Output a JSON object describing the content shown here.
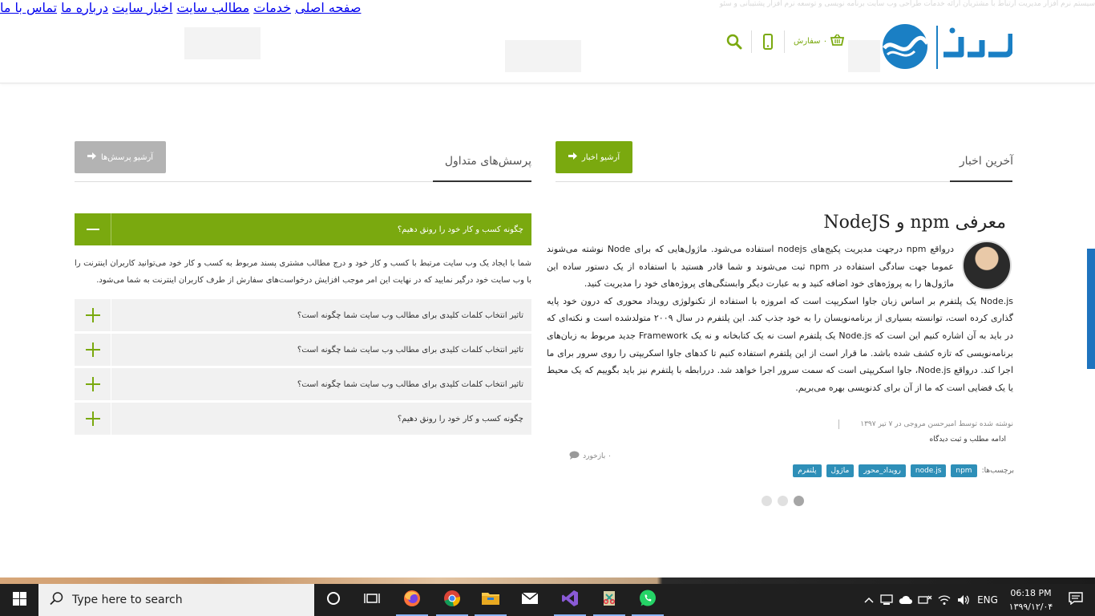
{
  "header": {
    "nav": [
      "صفحه اصلی",
      "خدمات",
      "مطالب سایت",
      "اخبار سایت",
      "درباره ما",
      "تماس با ما"
    ],
    "cart_label": "۰ سفارش",
    "ghost_text": "سیستم نرم افزار مدیریت ارتباط با مشتریان   ارائه خدمات طراحی وب سایت   برنامه نویسی و توسعه نرم افزار   پشتیبانی و سئو"
  },
  "news": {
    "section_title": "آخرین اخبار",
    "archive_button": "آرشیو اخبار",
    "title": "معرفی npm و NodeJS",
    "paragraphs": [
      "درواقع npm درجهت مدیریت پکیج‌های nodejs استفاده می‌شود. ماژول‌هایی که برای Node نوشته می‌شوند عموما جهت سادگی استفاده در npm ثبت می‌شوند و شما قادر هستید با استفاده از یک دستور ساده این ماژول‌ها را به پروژه‌های خود اضافه کنید و به عبارت دیگر وابستگی‌های پروژه‌های خود را مدیریت کنید.",
      "Node.js یک پلتفرم بر اساس زبان جاوا اسکریپت است که امروزه با استفاده از تکنولوژی رویداد محوری که درون خود پایه گذاری کرده است، توانسته بسیاری از برنامه‌نویسان را به خود جذب کند. این پلتفرم در سال ۲۰۰۹ متولدشده است و نکته‌ای که در باید به آن اشاره کنیم این است که Node.js یک پلتفرم است نه یک کتابخانه و نه یک Framework جدید مربوط به زبان‌های برنامه‌نویسی که تازه کشف شده باشد. ما قرار است از این پلتفرم استفاده کنیم تا کدهای جاوا اسکریپتی را روی سرور برای ما اجرا کند. درواقع Node.js، جاوا اسکریپتی است که سمت سرور اجرا خواهد شد. دررابطه با پلتفرم نیز باید بگوییم که یک محیط یا یک فضایی است که ما از آن برای کدنویسی بهره می‌بریم."
    ],
    "author_line": "نوشته شده توسط امیرحسن مروجی در ۷ تیر ۱۳۹۷",
    "read_more": "ادامه مطلب و ثبت دیدگاه",
    "comments": "۰ بازخورد",
    "tags_label": "برچسب‌ها:",
    "tags": [
      "npm",
      "node.js",
      "رویداد_محور",
      "ماژول",
      "پلتفرم"
    ]
  },
  "faq": {
    "section_title": "پرسش‌های متداول",
    "archive_button": "آرشیو پرسش‌ها",
    "open_question": "چگونه کسب و کار خود را رونق دهیم؟",
    "open_answer": "شما با ایجاد یک وب سایت مرتبط با کسب و کار خود و درج مطالب مشتری پسند مربوط به کسب و کار خود می‌توانید کاربران اینترنت را با وب سایت خود درگیر نمایید که در نهایت این امر موجب افزایش درخواست‌های سفارش از طرف کاربران اینترنت به شما می‌شود.",
    "items": [
      "تاثیر انتخاب کلمات کلیدی برای مطالب وب سایت شما چگونه است؟",
      "تاثیر انتخاب کلمات کلیدی برای مطالب وب سایت شما چگونه است؟",
      "تاثیر انتخاب کلمات کلیدی برای مطالب وب سایت شما چگونه است؟",
      "چگونه کسب و کار خود را رونق دهیم؟"
    ]
  },
  "taskbar": {
    "search_placeholder": "Type here to search",
    "lang": "ENG",
    "time": "06:18 PM",
    "date": "۱۳۹۹/۱۲/۰۴"
  },
  "colors": {
    "accent_green": "#7aa90f",
    "tag_blue": "#2e8fb8",
    "archive_gray": "#b3b3b3"
  }
}
